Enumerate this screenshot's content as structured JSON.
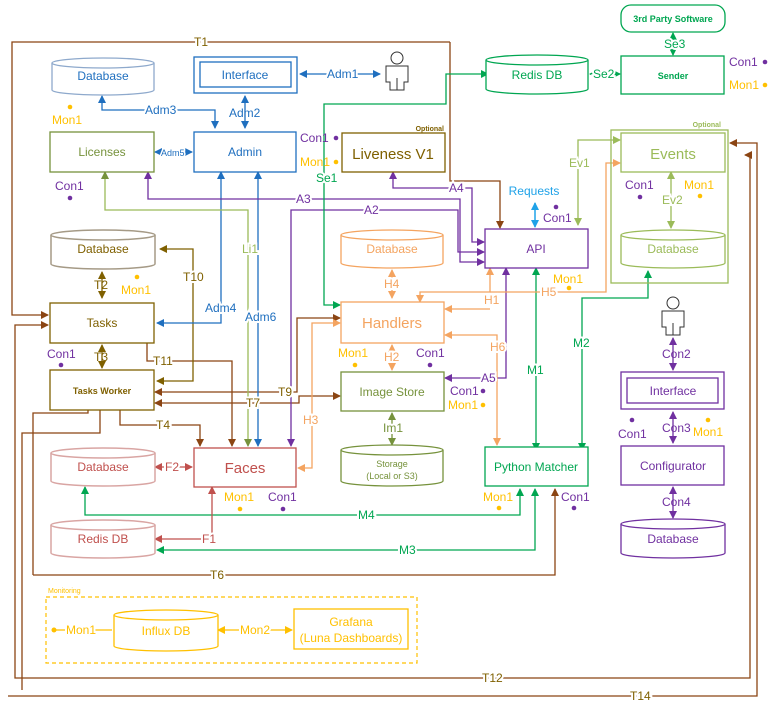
{
  "colors": {
    "blue": "#1f6fbf",
    "olive": "#76923c",
    "khaki": "#7f6000",
    "brown": "#8b4513",
    "orange": "#f4a460",
    "purple": "#7030a0",
    "green": "#00a651",
    "lightgreen": "#9bbb59",
    "red": "#c0504d",
    "yellow": "#ffc000",
    "cyan": "#1fa2e8",
    "gray": "#a59a86"
  },
  "nodes": {
    "admin_database": "Database",
    "admin_interface": "Interface",
    "licenses": "Licenses",
    "admin": "Admin",
    "liveness": "Liveness V1",
    "liveness_tag": "Optional",
    "redis_sender": "Redis DB",
    "third_party": "3rd Party Software",
    "sender": "Sender",
    "events": "Events",
    "events_tag": "Optional",
    "events_database": "Database",
    "api": "API",
    "requests": "Requests",
    "tasks_database": "Database",
    "tasks": "Tasks",
    "tasks_worker": "Tasks Worker",
    "handlers_database": "Database",
    "handlers": "Handlers",
    "image_store": "Image Store",
    "storage_line1": "Storage",
    "storage_line2": "(Local or S3)",
    "faces_database": "Database",
    "faces": "Faces",
    "faces_redis": "Redis DB",
    "python_matcher": "Python Matcher",
    "config_interface": "Interface",
    "configurator": "Configurator",
    "config_database": "Database",
    "monitoring_tag": "Monitoring",
    "influx": "Influx DB",
    "grafana_line1": "Grafana",
    "grafana_line2": "(Luna Dashboards)"
  },
  "edges": {
    "T1": "T1",
    "T2": "T2",
    "T3": "T3",
    "T4": "T4",
    "T6": "T6",
    "T7": "T7",
    "T9": "T9",
    "T10": "T10",
    "T11": "T11",
    "T12": "T12",
    "T14": "T14",
    "Adm1": "Adm1",
    "Adm2": "Adm2",
    "Adm3": "Adm3",
    "Adm4": "Adm4",
    "Adm5": "Adm5",
    "Adm6": "Adm6",
    "Li1": "Li1",
    "Se1": "Se1",
    "Se2": "Se2",
    "Se3": "Se3",
    "A2": "A2",
    "A3": "A3",
    "A4": "A4",
    "A5": "A5",
    "Ev1": "Ev1",
    "Ev2": "Ev2",
    "H1": "H1",
    "H2": "H2",
    "H3": "H3",
    "H4": "H4",
    "H5": "H5",
    "H6": "H6",
    "Im1": "Im1",
    "F1": "F1",
    "F2": "F2",
    "M1": "M1",
    "M2": "M2",
    "M3": "M3",
    "M4": "M4",
    "Con1": "Con1",
    "Con2": "Con2",
    "Con3": "Con3",
    "Con4": "Con4",
    "Mon1": "Mon1",
    "Mon2": "Mon2"
  }
}
